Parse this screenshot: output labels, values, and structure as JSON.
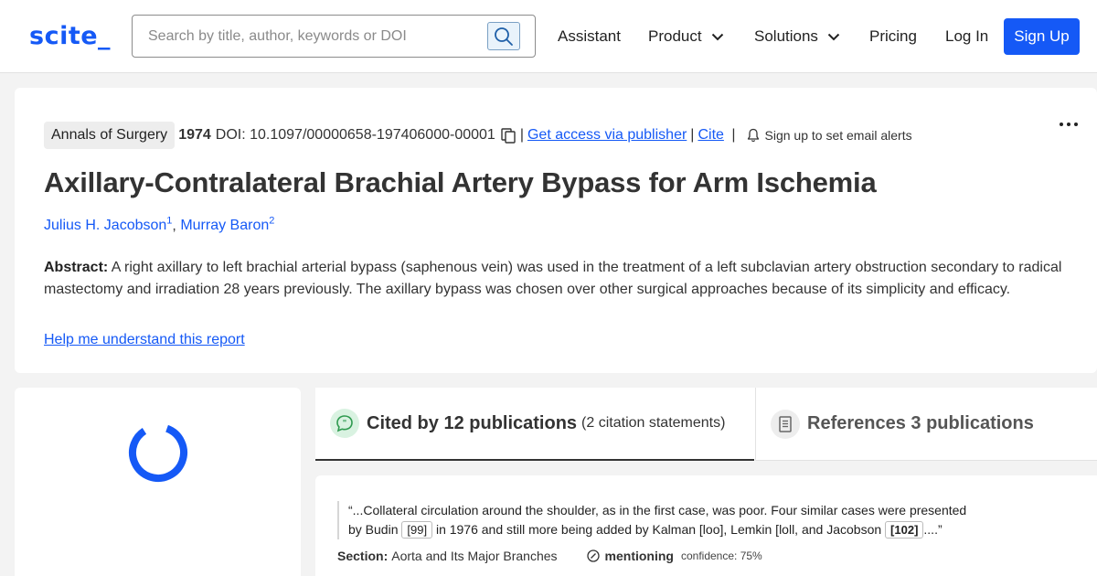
{
  "header": {
    "logo": "scite_",
    "search_placeholder": "Search by title, author, keywords or DOI",
    "nav": {
      "assistant": "Assistant",
      "product": "Product",
      "solutions": "Solutions",
      "pricing": "Pricing",
      "login": "Log In",
      "signup": "Sign Up"
    }
  },
  "paper": {
    "journal": "Annals of Surgery",
    "year": "1974",
    "doi": "DOI: 10.1097/00000658-197406000-00001",
    "access_link": "Get access via publisher",
    "cite_link": "Cite",
    "alert_text": "Sign up to set email alerts",
    "title": "Axillary-Contralateral Brachial Artery Bypass for Arm Ischemia",
    "authors": [
      {
        "name": "Julius H. Jacobson",
        "aff": "1"
      },
      {
        "name": "Murray Baron",
        "aff": "2"
      }
    ],
    "abstract_label": "Abstract:",
    "abstract_text": "A right axillary to left brachial arterial bypass (saphenous vein) was used in the treatment of a left subclavian artery obstruction secondary to radical mastectomy and irradiation 28 years previously. The axillary bypass was chosen over other surgical approaches because of its simplicity and efficacy.",
    "help_link": "Help me understand this report"
  },
  "tabs": {
    "cited_label": "Cited by 12 publications",
    "cited_sub": "(2 citation statements)",
    "refs_label": "References 3 publications"
  },
  "citation": {
    "quote_part1": "“...Collateral circulation around the shoulder, as in the first case, was poor. Four similar cases were presented by Budin ",
    "ref1": "[99]",
    "quote_part2": " in 1976 and still more being added by Kalman [loo], Lemkin [loll, and Jacobson ",
    "ref2": "[102]",
    "quote_part3": "....”",
    "section_label": "Section:",
    "section_value": "Aorta and Its Major Branches",
    "classification": "mentioning",
    "confidence": "confidence: 75%"
  },
  "colors": {
    "brand": "#1559f6",
    "cited_icon_bg": "#d9f2e1",
    "cited_icon": "#2e9a4f"
  },
  "icons": [
    "search-icon",
    "chevron-down-icon",
    "copy-icon",
    "bell-icon",
    "more-icon",
    "loading-spinner",
    "quote-bubble-icon",
    "document-icon",
    "mentioning-icon"
  ]
}
